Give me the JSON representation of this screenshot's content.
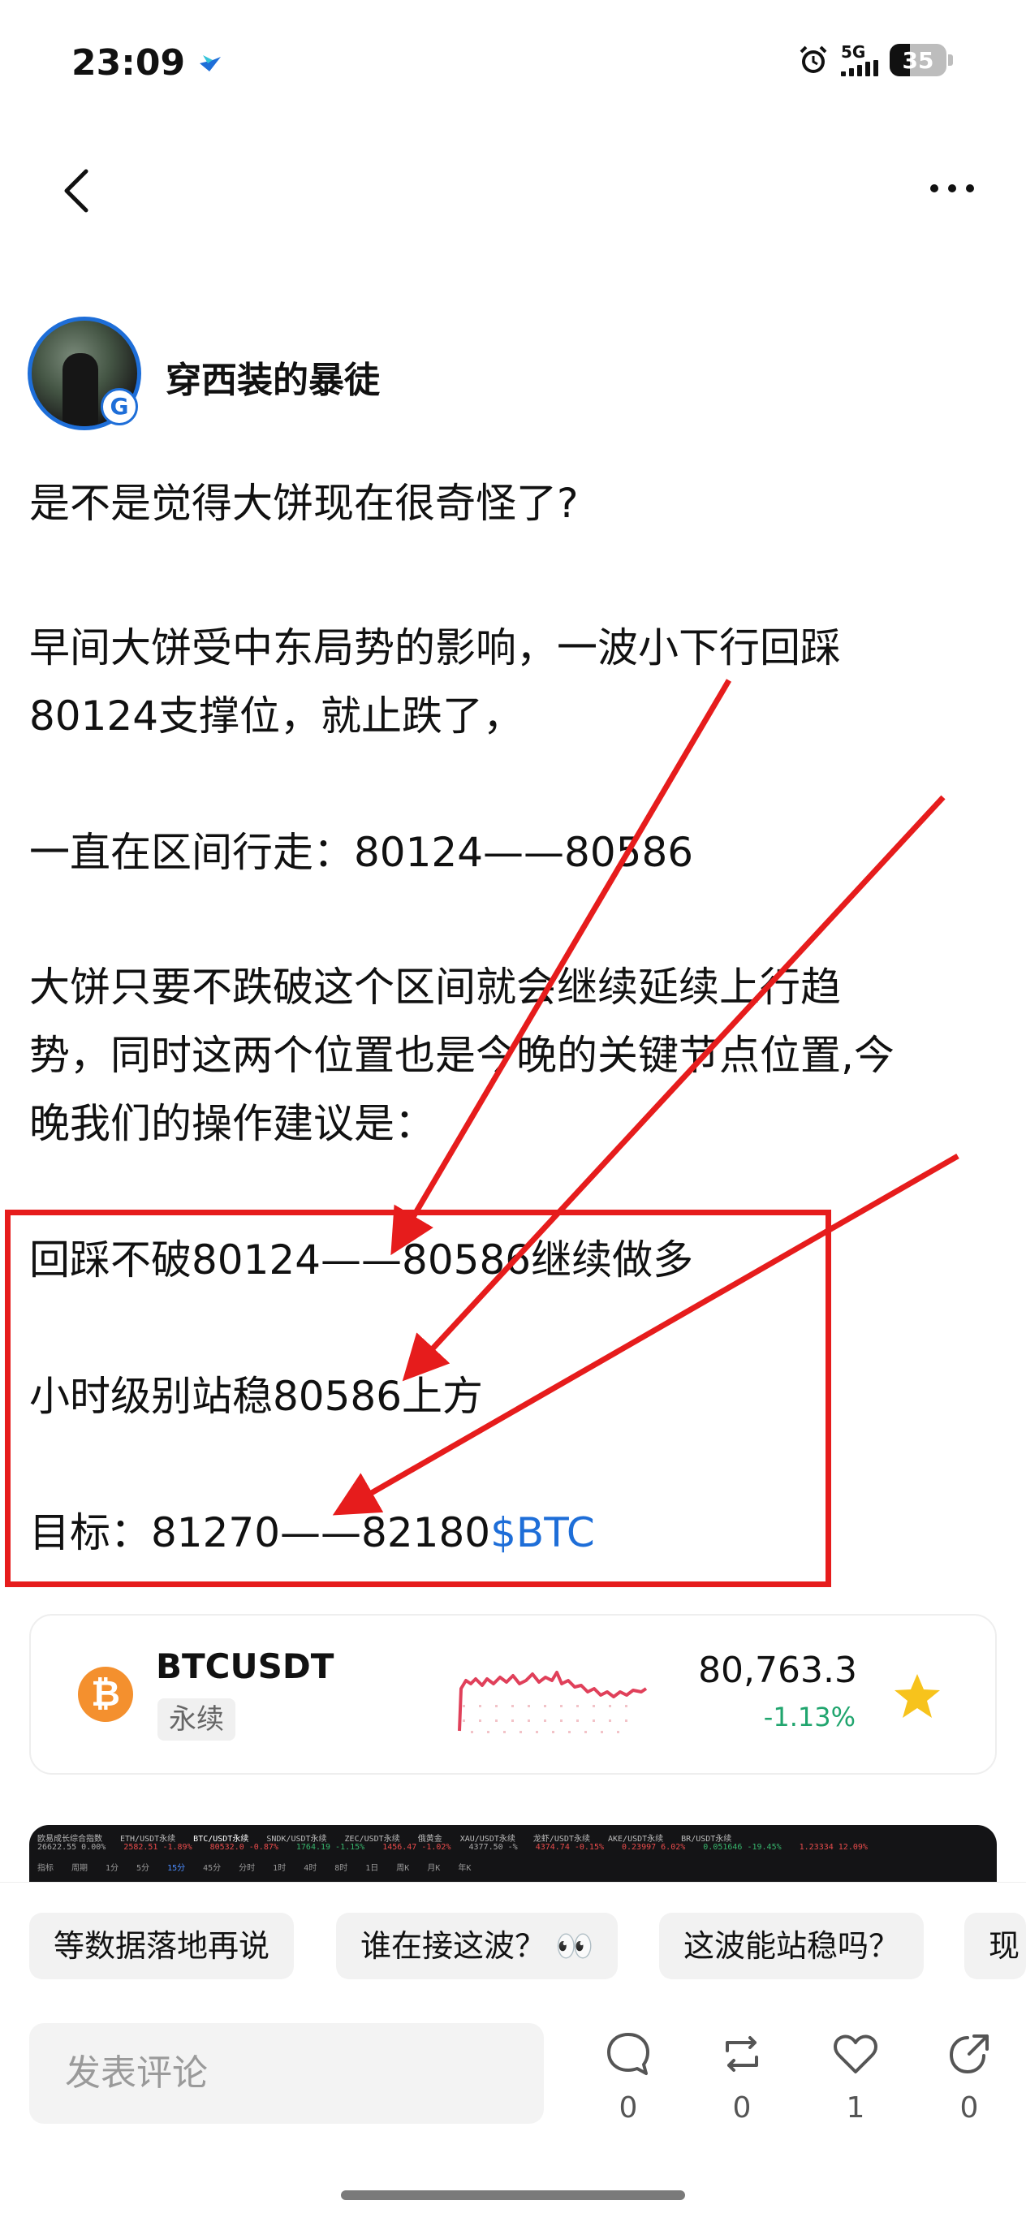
{
  "status_bar": {
    "time": "23:09",
    "network": "5G",
    "battery": "35"
  },
  "nav": {
    "back_icon": "chevron-left-icon",
    "more_icon": "ellipsis-icon"
  },
  "author": {
    "name": "穿西装的暴徒",
    "badge": "G"
  },
  "post": {
    "lines": [
      "是不是觉得大饼现在很奇怪了?",
      "早间大饼受中东局势的影响，一波小下行回踩",
      "80124支撑位，就止跌了，",
      "一直在区间行走：80124——80586",
      "大饼只要不跌破这个区间就会继续延续上行趋",
      "势，同时这两个位置也是今晚的关键节点位置,今",
      "晚我们的操作建议是：",
      "回踩不破80124——80586继续做多",
      "小时级别站稳80586上方",
      "目标：81270——82180"
    ],
    "cashtag": "$BTC"
  },
  "ticker": {
    "symbol": "BTCUSDT",
    "tag": "永续",
    "price": "80,763.3",
    "change": "-1.13%",
    "icon": "bitcoin-icon",
    "favorite_icon": "star-icon",
    "change_color": "#20a56e",
    "star_color": "#f7c31c"
  },
  "chart_strip": {
    "row1": [
      "欧易成长综合指数",
      "ETH/USDT永续",
      "BTC/USDT永续",
      "SNDK/USDT永续",
      "ZEC/USDT永续",
      "俄黄金",
      "XAU/USDT永续",
      "龙虾/USDT永续",
      "AKE/USDT永续",
      "BR/USDT永续"
    ],
    "row2": [
      "26622.55 0.00%",
      "2582.51 -1.89%",
      "80532.0 -0.87%",
      "1764.19 -1.15%",
      "1456.47 -1.02%",
      "4377.50 -%",
      "4374.74 -0.15%",
      "0.23997 6.02%",
      "0.051646 -19.45%",
      "1.23334 12.09%"
    ],
    "row3": [
      "指标",
      "周期",
      "1分",
      "5分",
      "15分",
      "45分",
      "分时",
      "1时",
      "4时",
      "8时",
      "1日",
      "周K",
      "月K",
      "年K"
    ]
  },
  "quick_replies": [
    "等数据落地再说",
    "谁在接这波？ 👀",
    "这波能站稳吗？",
    "现"
  ],
  "comment": {
    "placeholder": "发表评论"
  },
  "actions": [
    {
      "icon": "comment-icon",
      "count": "0"
    },
    {
      "icon": "repost-icon",
      "count": "0"
    },
    {
      "icon": "heart-icon",
      "count": "1"
    },
    {
      "icon": "share-icon",
      "count": "0"
    }
  ],
  "annotation_color": "#e61c1c",
  "accent_color": "#1e6ed8"
}
